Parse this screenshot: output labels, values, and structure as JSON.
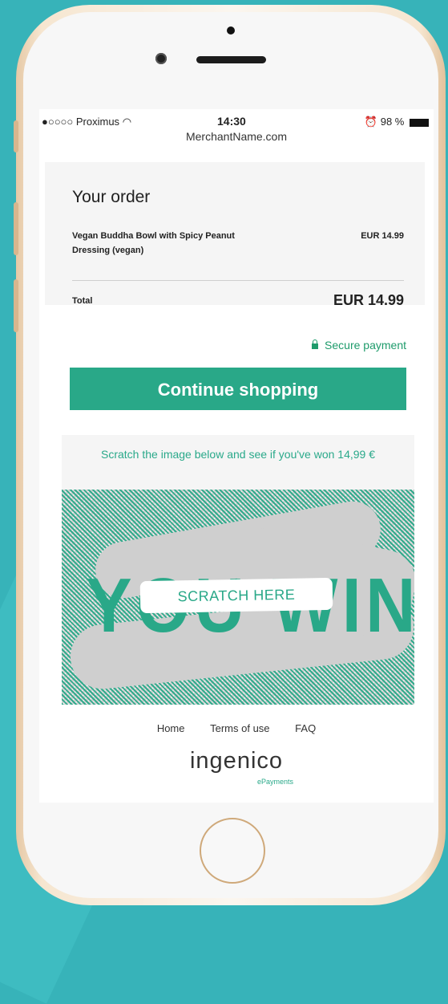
{
  "status_bar": {
    "carrier": "●○○○○ Proximus",
    "time": "14:30",
    "battery": "98 %"
  },
  "url": "MerchantName.com",
  "order": {
    "title": "Your order",
    "item_name": "Vegan Buddha Bowl with Spicy Peanut Dressing (vegan)",
    "item_price": "EUR 14.99",
    "total_label": "Total",
    "total_value": "EUR 14.99"
  },
  "secure_label": "Secure payment",
  "continue_label": "Continue shopping",
  "scratch": {
    "prompt": "Scratch the image below and see if you've won 14,99 €",
    "hidden_text": "YOU WIN",
    "button_label": "SCRATCH HERE"
  },
  "footer": {
    "links": [
      "Home",
      "Terms of use",
      "FAQ"
    ]
  },
  "logo": {
    "name": "ingenico",
    "sub": "ePayments"
  },
  "colors": {
    "accent": "#29a888",
    "background": "#37b3b9"
  }
}
